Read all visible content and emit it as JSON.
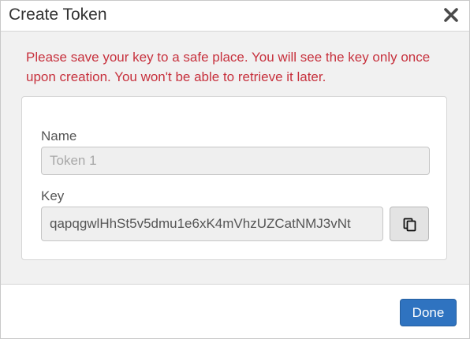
{
  "dialog": {
    "title": "Create Token",
    "close_icon": "close-x-icon"
  },
  "warning": {
    "text": "Please save your key to a safe place. You will see the key only once upon creation. You won't be able to retrieve it later.",
    "color": "#c7313d"
  },
  "form": {
    "name_label": "Name",
    "name_placeholder": "Token 1",
    "name_value": "",
    "key_label": "Key",
    "key_value": "qapqgwlHhSt5v5dmu1e6xK4mVhzUZCatNMJ3vNt",
    "copy_icon": "copy-icon"
  },
  "footer": {
    "done_label": "Done",
    "accent": "#2f73c0"
  }
}
